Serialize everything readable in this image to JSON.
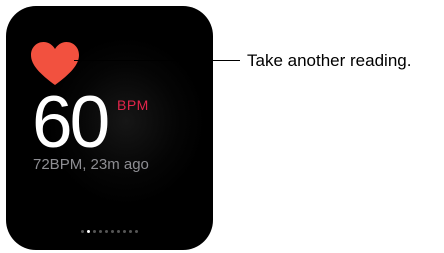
{
  "watch": {
    "heart_rate": "60",
    "unit": "BPM",
    "last_reading": "72BPM, 23m ago",
    "page_count": 10,
    "active_page": 2
  },
  "callout": {
    "text": "Take another reading."
  },
  "colors": {
    "heart": "#f2513f",
    "unit": "#e0254a",
    "secondary_text": "#8e8e93",
    "screen_background": "#000000"
  },
  "icons": {
    "heart": "heart-icon"
  }
}
